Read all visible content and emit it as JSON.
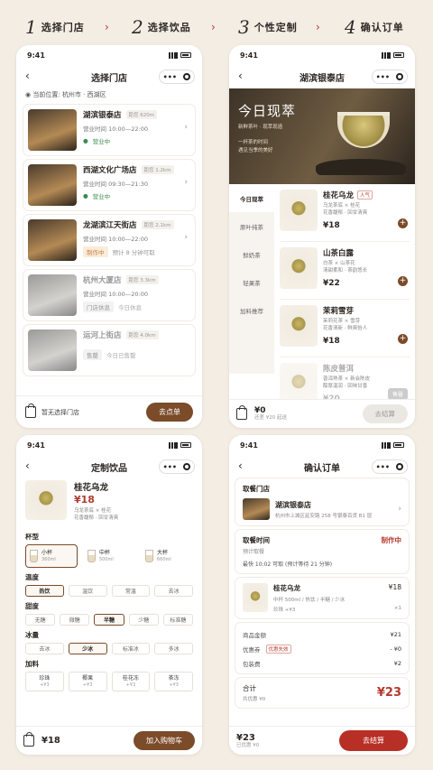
{
  "steps": [
    {
      "num": "1",
      "label": "选择门店"
    },
    {
      "num": "2",
      "label": "选择饮品"
    },
    {
      "num": "3",
      "label": "个性定制"
    },
    {
      "num": "4",
      "label": "确认订单"
    }
  ],
  "arrow": "›",
  "status_time": "9:41",
  "capsule_dots": "•••",
  "back_symbol": "‹",
  "chevron": "›",
  "store_select": {
    "title": "选择门店",
    "location_label": "当前位置:",
    "location_value": "杭州市 · 西湖区",
    "stores": [
      {
        "name": "湖滨银泰店",
        "distance": "距您 620m",
        "hours": "营业时间 10:00—22:00",
        "status": "营业中",
        "extra": ""
      },
      {
        "name": "西湖文化广场店",
        "distance": "距您 1.2km",
        "hours": "营业时间 09:30—21:30",
        "status": "营业中",
        "extra": ""
      },
      {
        "name": "龙湖滨江天街店",
        "distance": "距您 2.1km",
        "hours": "营业时间 10:00—22:00",
        "status": "制作中",
        "extra": "预计 8 分钟可取"
      },
      {
        "name": "杭州大厦店",
        "distance": "距您 3.3km",
        "hours": "营业时间 10:00—20:00",
        "status": "门店休息",
        "extra": "今日休息"
      },
      {
        "name": "运河上街店",
        "distance": "距您 4.0km",
        "hours": "",
        "status": "售罄",
        "extra": "今日已售罄"
      }
    ],
    "bottom_text": "暂无选择门店",
    "button": "去点单"
  },
  "drink_select": {
    "title": "湖滨银泰店",
    "banner": {
      "title": "今日现萃",
      "subtitle": "新鲜茶叶 · 现萃现造",
      "line1": "一杯茶的时间",
      "line2": "遇见当季的美好"
    },
    "categories": [
      "今日现萃",
      "原叶纯茶",
      "鲜奶茶",
      "轻果茶",
      "加料推荐"
    ],
    "products": [
      {
        "name": "桂花乌龙",
        "tag": "人气",
        "desc1": "乌龙茶底 × 桂花",
        "desc2": "花香馥郁 · 回甘清爽",
        "price": "¥18"
      },
      {
        "name": "山茶白露",
        "tag": "",
        "desc1": "白茶 × 山茶花",
        "desc2": "清甜柔和 · 茶韵悠长",
        "price": "¥22"
      },
      {
        "name": "茉莉雪芽",
        "tag": "",
        "desc1": "茉莉花茶 × 雪芽",
        "desc2": "花香清新 · 鲜爽怡人",
        "price": "¥18"
      },
      {
        "name": "陈皮普洱",
        "tag": "",
        "desc1": "普洱熟茶 × 新会陈皮",
        "desc2": "醇厚温润 · 回味甘香",
        "price": "¥20",
        "sold": "售罄"
      }
    ],
    "cart_amount": "¥0",
    "cart_note": "还差 ¥20 起送",
    "button": "去结算"
  },
  "customize": {
    "title": "定制饮品",
    "name": "桂花乌龙",
    "price": "¥18",
    "desc1": "乌龙茶底 × 桂花",
    "desc2": "花香馥郁 · 回甘清爽",
    "cup_label": "杯型",
    "cups": [
      {
        "name": "小杯",
        "ml": "360ml"
      },
      {
        "name": "中杯",
        "ml": "500ml"
      },
      {
        "name": "大杯",
        "ml": "660ml"
      }
    ],
    "temp_label": "温度",
    "temps": [
      "热饮",
      "温饮",
      "常温",
      "去冰"
    ],
    "sugar_label": "甜度",
    "sugars": [
      "无糖",
      "微糖",
      "半糖",
      "少糖",
      "标准糖"
    ],
    "ice_label": "冰量",
    "ices": [
      "去冰",
      "少冰",
      "标准冰",
      "多冰"
    ],
    "topping_label": "加料",
    "toppings": [
      {
        "name": "珍珠",
        "price": "+¥3"
      },
      {
        "name": "椰果",
        "price": "+¥3"
      },
      {
        "name": "桂花冻",
        "price": "+¥3"
      },
      {
        "name": "茶冻",
        "price": "+¥3"
      }
    ],
    "total": "¥18",
    "button": "加入购物车"
  },
  "confirm": {
    "title": "确认订单",
    "store_label": "取餐门店",
    "store_name": "湖滨银泰店",
    "store_addr": "杭州市上城区延安路 258 号银泰百货 B1 层",
    "time_label": "取餐时间",
    "time_status": "制作中",
    "time_sub": "预计取餐",
    "time_detail": "最快 10:02 可取 (预计等待 21 分钟)",
    "item_name": "桂花乌龙",
    "item_price": "¥18",
    "item_spec": "中杯 500ml / 热饮 / 半糖 / 少冰",
    "item_topping": "珍珠 +¥3",
    "item_qty": "×1",
    "goods_label": "商品金额",
    "goods_value": "¥21",
    "coupon_label": "优惠券",
    "coupon_tag": "优惠失效",
    "coupon_value": "- ¥0",
    "pack_label": "包装费",
    "pack_value": "¥2",
    "total_label": "合计",
    "total_value": "¥23",
    "saved": "共优惠 ¥0",
    "bottom_amount": "¥23",
    "bottom_saved": "已优惠 ¥0",
    "button": "去结算"
  }
}
